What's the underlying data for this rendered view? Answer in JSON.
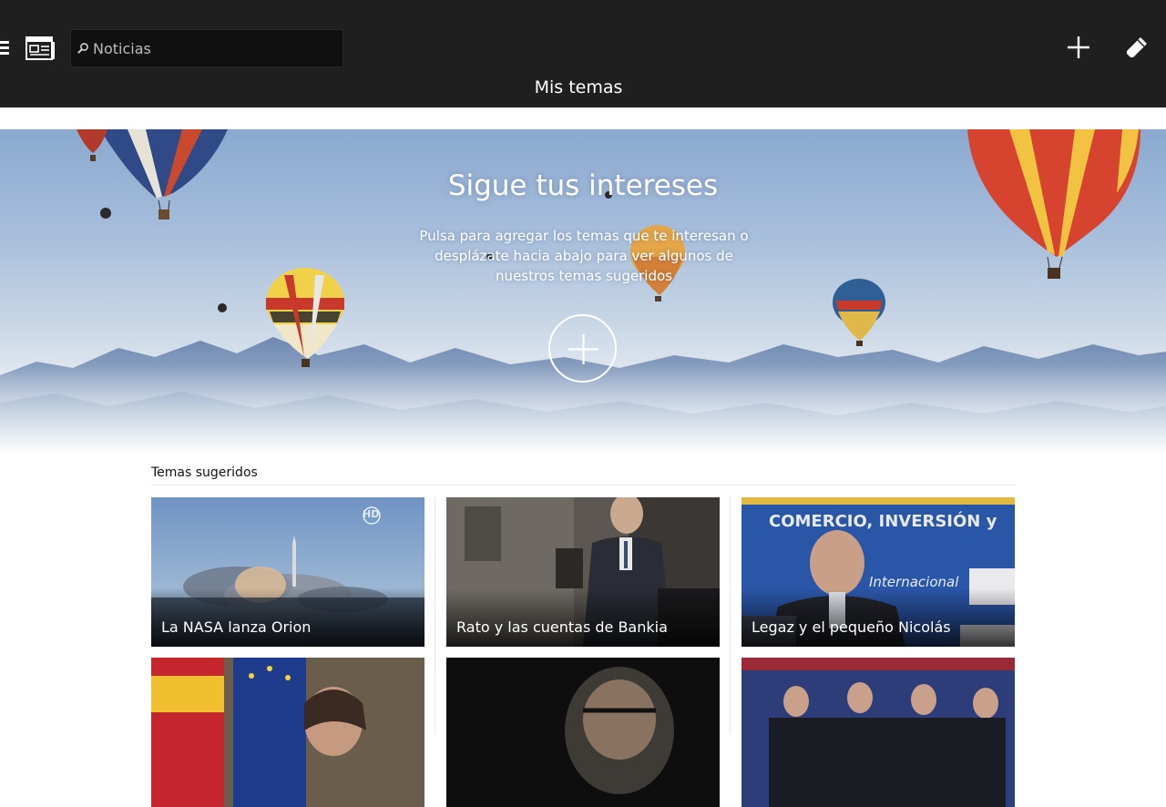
{
  "search": {
    "placeholder": "Noticias"
  },
  "header": {
    "title": "Mis temas"
  },
  "hero": {
    "title": "Sigue tus intereses",
    "subtitle": "Pulsa para agregar los temas que te interesan o desplázate hacia abajo para ver algunos de nuestros temas sugeridos"
  },
  "suggested": {
    "heading": "Temas sugeridos",
    "tiles": [
      {
        "label": "La NASA lanza Orion",
        "badge": "HD"
      },
      {
        "label": "Rato y las cuentas de Bankia"
      },
      {
        "label": "Legaz y el pequeño Nicolás",
        "photo_text_1": "COMERCIO, INVERSIÓN y",
        "photo_text_2": "Internacional"
      }
    ]
  },
  "colors": {
    "topbar": "#1f1f1f",
    "search_bg": "#101010",
    "text_light": "#ffffff"
  },
  "icons": [
    "menu-icon",
    "news-app-icon",
    "search-icon",
    "add-icon",
    "edit-icon",
    "add-circle-icon"
  ]
}
